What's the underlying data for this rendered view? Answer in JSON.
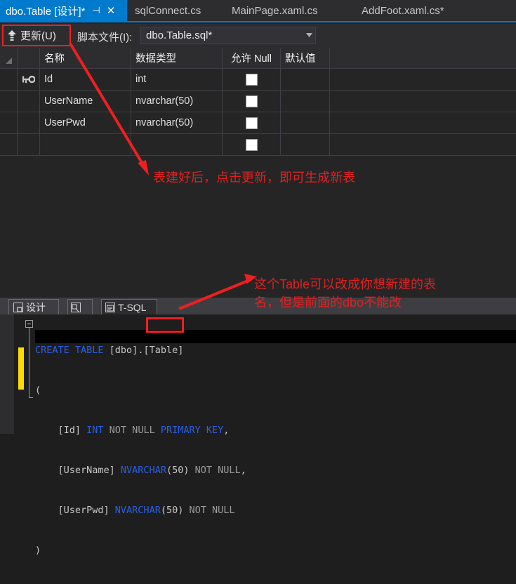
{
  "tabs": [
    {
      "label": "dbo.Table [设计]*",
      "active": true,
      "pin": "⊣",
      "close": "✕"
    },
    {
      "label": "sqlConnect.cs",
      "active": false
    },
    {
      "label": "MainPage.xaml.cs",
      "active": false
    },
    {
      "label": "AddFoot.xaml.cs*",
      "active": false
    }
  ],
  "toolbar": {
    "update_label": "更新(U)",
    "update_icon": "up-arrow-icon",
    "script_file_label": "脚本文件(I):",
    "script_file_value": "dbo.Table.sql*",
    "dropdown_caret": "▼"
  },
  "grid": {
    "headers": {
      "select": "",
      "key": "",
      "name": "名称",
      "type": "数据类型",
      "allow_null": "允许 Null",
      "default": "默认值",
      "rest": ""
    },
    "rows": [
      {
        "key_icon": "primary-key-icon",
        "name": "Id",
        "type": "int",
        "allow_null": false,
        "default": ""
      },
      {
        "key_icon": "",
        "name": "UserName",
        "type": "nvarchar(50)",
        "allow_null": false,
        "default": ""
      },
      {
        "key_icon": "",
        "name": "UserPwd",
        "type": "nvarchar(50)",
        "allow_null": false,
        "default": ""
      },
      {
        "key_icon": "",
        "name": "",
        "type": "",
        "allow_null": false,
        "default": ""
      }
    ]
  },
  "bottom_tabs": [
    {
      "label": "设计",
      "icon": "design-icon",
      "active": false
    },
    {
      "label": "",
      "icon": "split-view-icon",
      "active": false
    },
    {
      "label": "T-SQL",
      "icon": "sql-script-icon",
      "active": true
    }
  ],
  "editor": {
    "lines": [
      {
        "segments": [
          {
            "t": "CREATE TABLE",
            "c": "kw"
          },
          {
            "t": " [dbo].[Table]",
            "c": "pl"
          }
        ]
      },
      {
        "segments": [
          {
            "t": "(",
            "c": "pl"
          }
        ]
      },
      {
        "segments": [
          {
            "t": "    [Id] ",
            "c": "pl"
          },
          {
            "t": "INT",
            "c": "kw"
          },
          {
            "t": " NOT NULL ",
            "c": "dim"
          },
          {
            "t": "PRIMARY KEY",
            "c": "kw"
          },
          {
            "t": ",",
            "c": "pl"
          }
        ]
      },
      {
        "segments": [
          {
            "t": "    [UserName] ",
            "c": "pl"
          },
          {
            "t": "NVARCHAR",
            "c": "kw"
          },
          {
            "t": "(50)",
            "c": "pl"
          },
          {
            "t": " NOT NULL",
            "c": "dim"
          },
          {
            "t": ",",
            "c": "pl"
          }
        ]
      },
      {
        "segments": [
          {
            "t": "    [UserPwd] ",
            "c": "pl"
          },
          {
            "t": "NVARCHAR",
            "c": "kw"
          },
          {
            "t": "(50)",
            "c": "pl"
          },
          {
            "t": " NOT NULL",
            "c": "dim"
          }
        ]
      },
      {
        "segments": [
          {
            "t": ")",
            "c": "pl"
          }
        ]
      }
    ]
  },
  "annotations": [
    {
      "text": "表建好后，点击更新，即可生成新表"
    },
    {
      "text": "这个Table可以改成你想新建的表\n名，但是前面的dbo不能改"
    }
  ],
  "colors": {
    "accent": "#007acc",
    "annotation_red": "#e02020",
    "highlight_box": "#f01f1f",
    "keyword_blue": "#2a5fe8",
    "change_bar_yellow": "#fcdc00"
  }
}
